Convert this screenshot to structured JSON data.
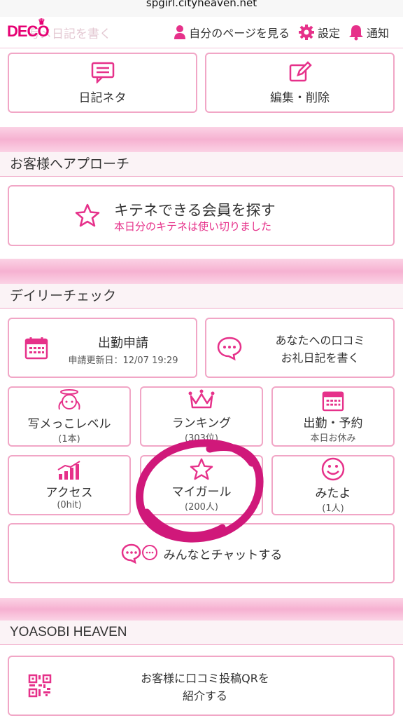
{
  "browser": {
    "url": "spgirl.cityheaven.net"
  },
  "header": {
    "logo": "DECO",
    "faded_title": "写メ日記を書く",
    "my_page": "自分のページを見る",
    "settings": "設定",
    "notifications": "通知"
  },
  "diary": {
    "ideas": "日記ネタ",
    "edit": "編集・削除"
  },
  "approach": {
    "heading": "お客様へアプローチ",
    "kitene_title": "キテネできる会員を探す",
    "kitene_note": "本日分のキテネは使い切りました"
  },
  "daily": {
    "heading": "デイリーチェック",
    "attendance_title": "出勤申請",
    "attendance_sub": "申請更新日：12/07 19:29",
    "review_line1": "あなたへの口コミ",
    "review_line2": "お礼日記を書く",
    "photo_level": "写メっこレベル",
    "photo_level_count": "(1本)",
    "ranking": "ランキング",
    "ranking_rank": "(303位)",
    "schedule": "出勤・予約",
    "schedule_note": "本日お休み",
    "access": "アクセス",
    "access_count": "(0hit)",
    "mygirl": "マイガール",
    "mygirl_count": "(200人)",
    "mitayo": "みたよ",
    "mitayo_count": "(1人)",
    "chat": "みんなとチャットする"
  },
  "yoasobi": {
    "heading": "YOASOBI HEAVEN",
    "qr_line1": "お客様に口コミ投稿QRを",
    "qr_line2": "紹介する"
  },
  "colors": {
    "accent": "#e6318a",
    "border": "#f1a6c6",
    "band": "#f6b1d1"
  }
}
